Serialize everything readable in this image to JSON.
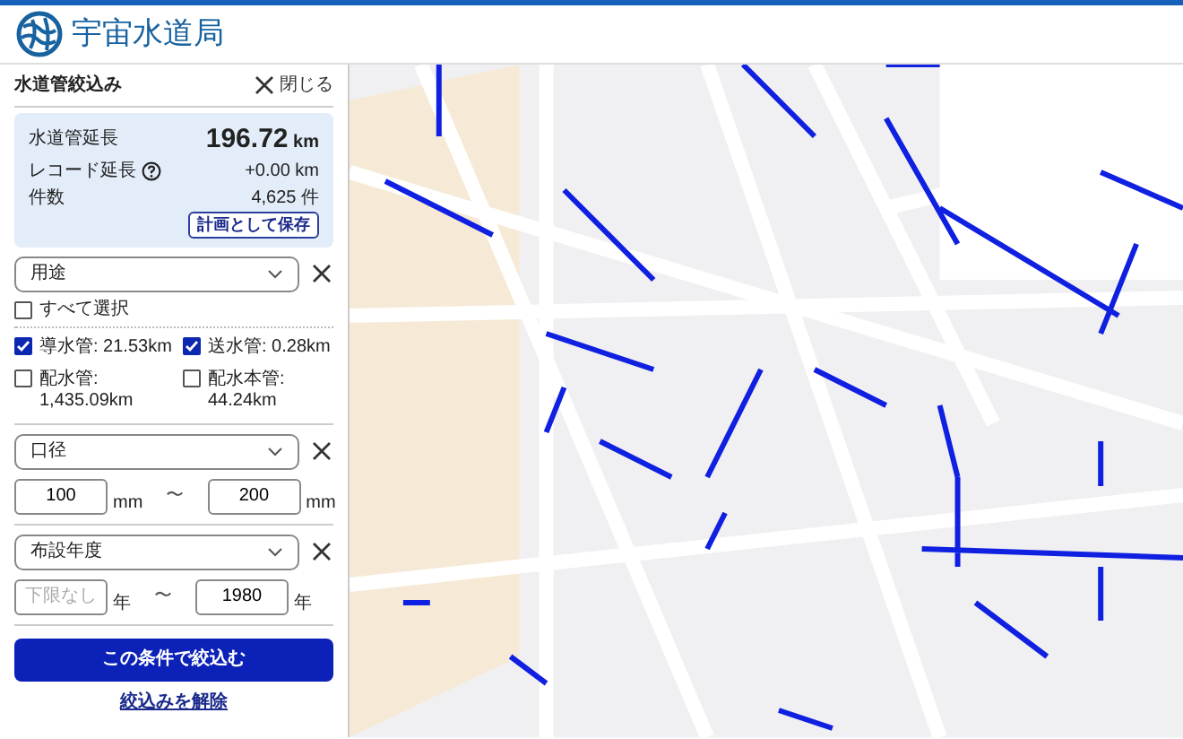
{
  "app": {
    "title": "宇宙水道局"
  },
  "panel": {
    "title": "水道管絞込み",
    "close_label": "閉じる"
  },
  "summary": {
    "rows": [
      {
        "kind": "main",
        "label": "水道管延長",
        "value": "196.72",
        "unit": "km"
      },
      {
        "kind": "help",
        "label": "レコード延長",
        "value": "+0.00 km"
      },
      {
        "kind": "plain",
        "label": "件数",
        "value": "4,625 件"
      }
    ],
    "save_button": "計画として保存"
  },
  "filters": [
    {
      "kind": "checklist",
      "select": "用途",
      "select_all": {
        "label": "すべて選択",
        "checked": false
      },
      "items": [
        {
          "label": "導水管: 21.53km",
          "checked": true
        },
        {
          "label": "送水管: 0.28km",
          "checked": true
        },
        {
          "label": "配水管: 1,435.09km",
          "checked": false
        },
        {
          "label": "配水本管: 44.24km",
          "checked": false
        }
      ]
    },
    {
      "kind": "range",
      "select": "口径",
      "from": "100",
      "from_unit": "mm",
      "to": "200",
      "to_unit": "mm",
      "separator": "〜"
    },
    {
      "kind": "range",
      "select": "布設年度",
      "from_placeholder": "下限なし",
      "from_unit": "年",
      "to": "1980",
      "to_unit": "年",
      "separator": "〜"
    }
  ],
  "apply_button": "この条件で絞込む",
  "clear_link": "絞込みを解除"
}
